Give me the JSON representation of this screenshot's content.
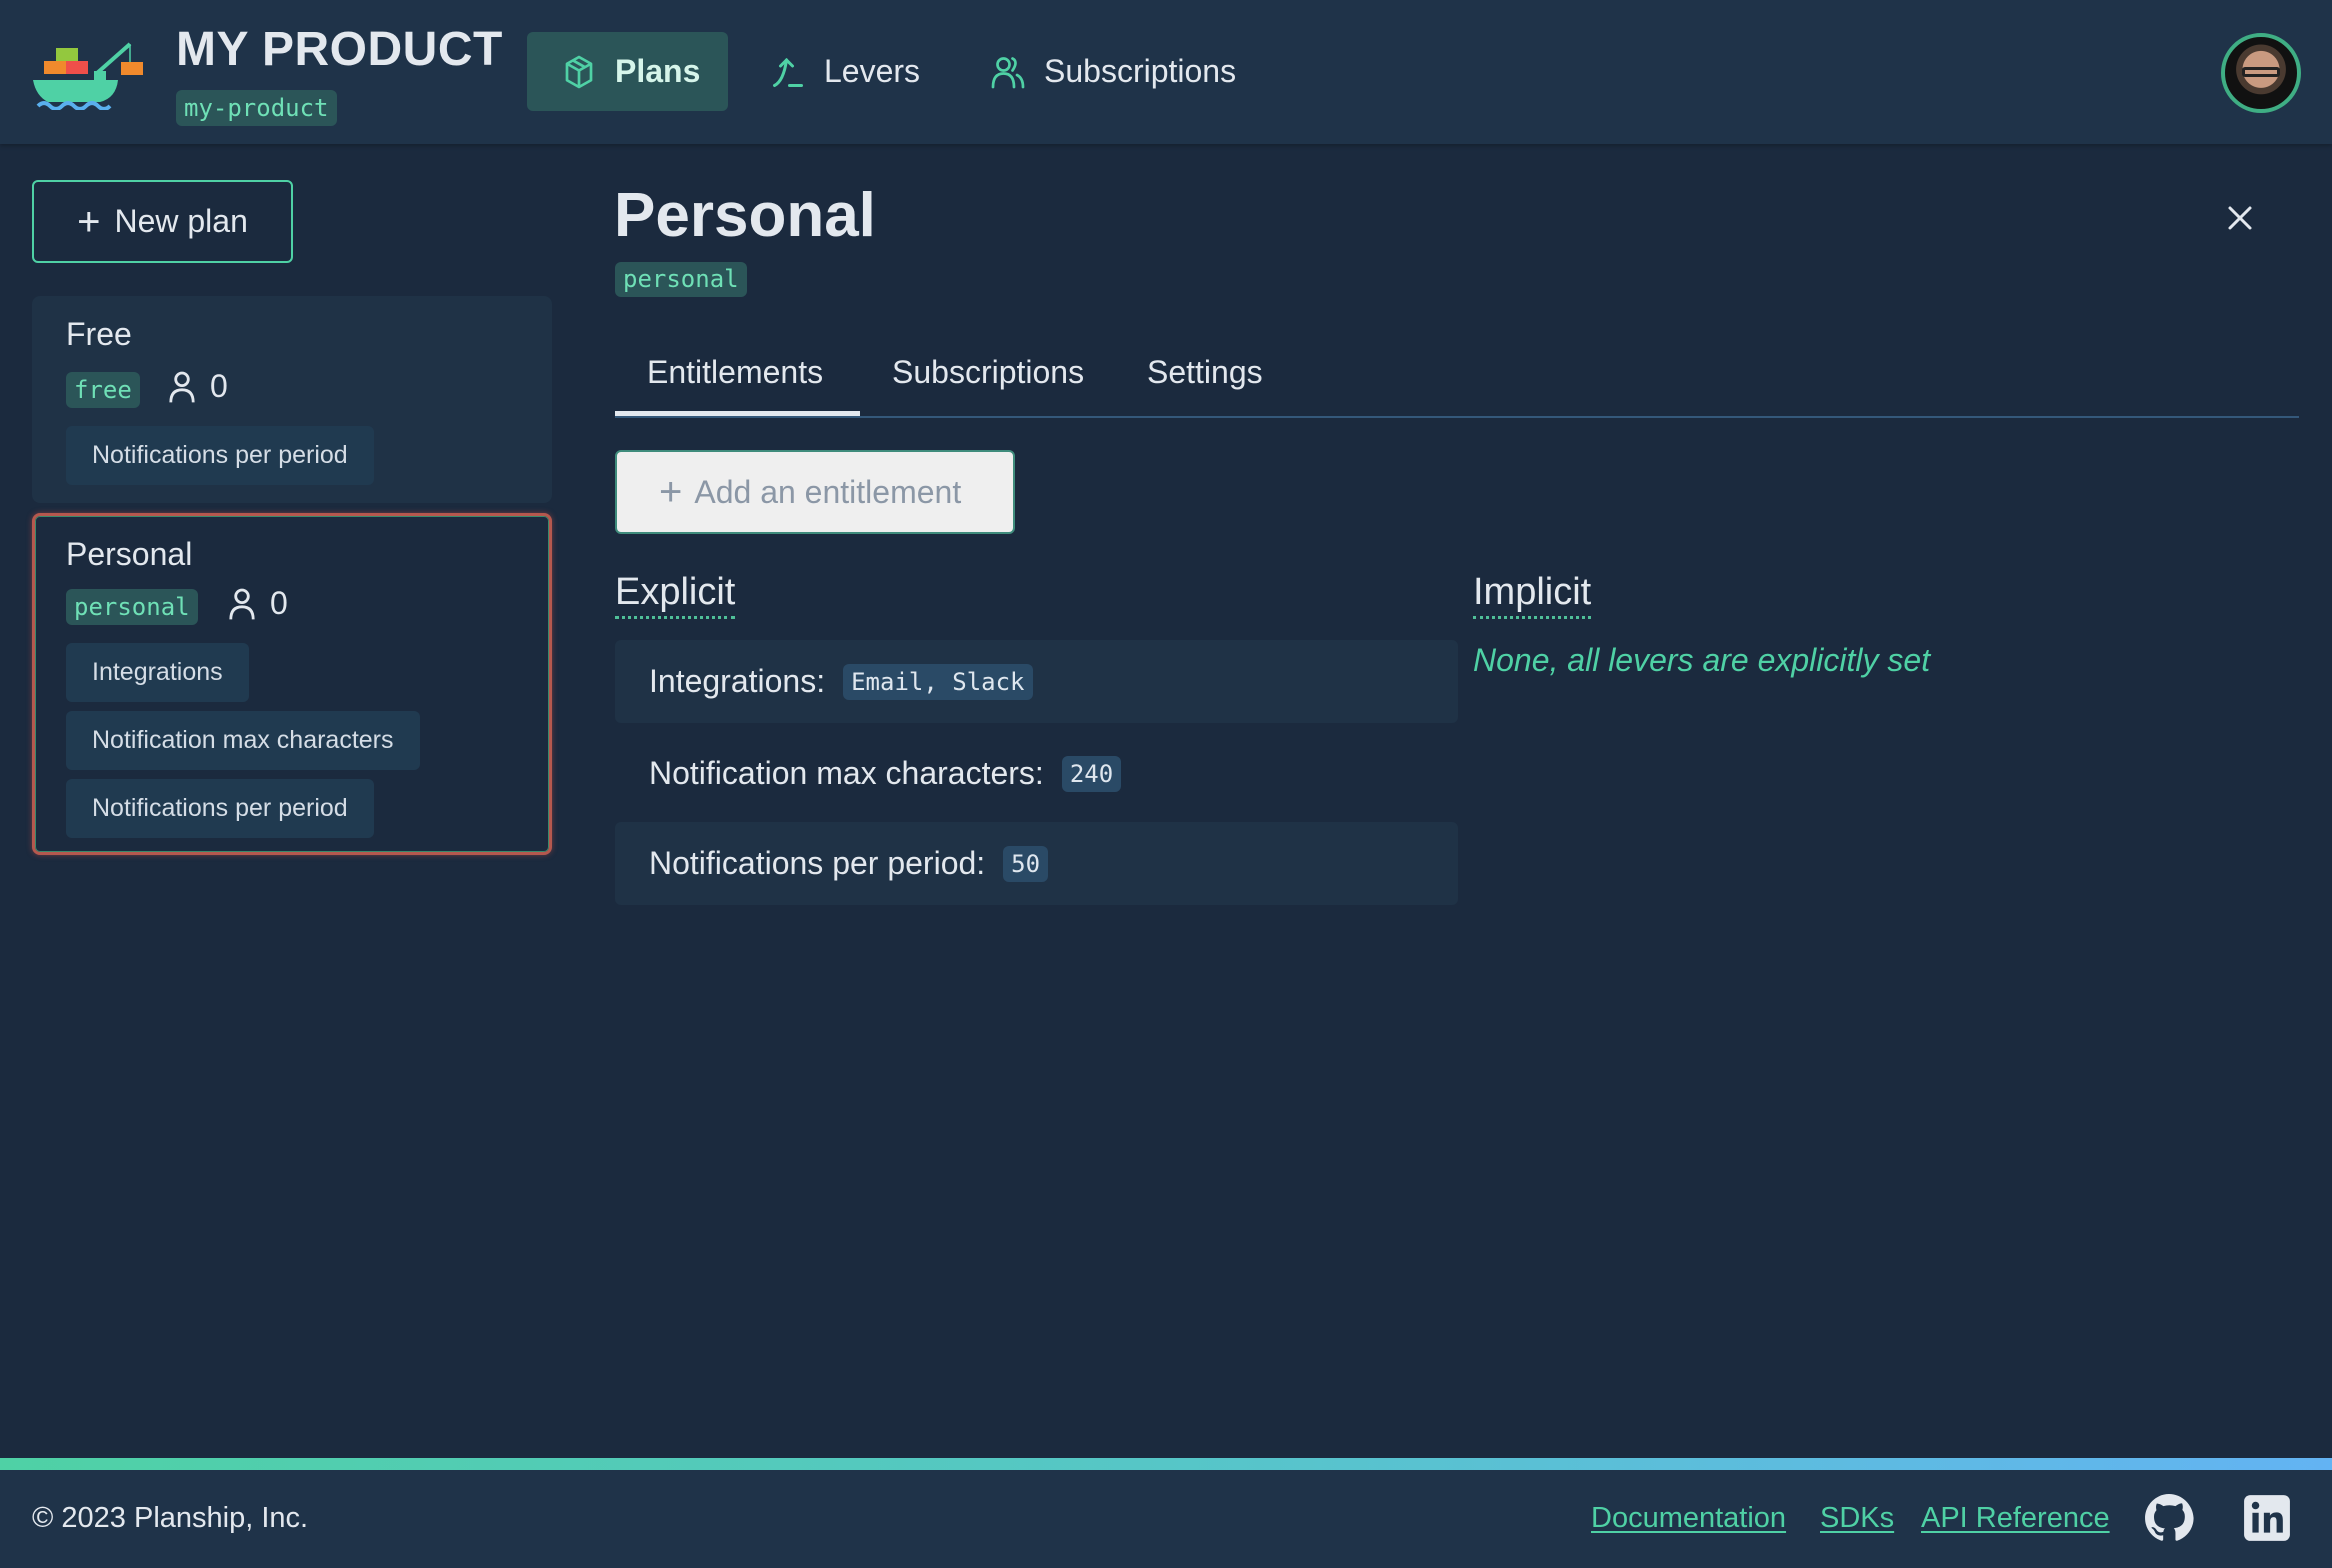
{
  "header": {
    "brand_title": "MY PRODUCT",
    "brand_slug": "my-product",
    "nav": [
      {
        "label": "Plans",
        "icon": "cube-icon",
        "active": true
      },
      {
        "label": "Levers",
        "icon": "lever-icon",
        "active": false
      },
      {
        "label": "Subscriptions",
        "icon": "users-icon",
        "active": false
      }
    ],
    "avatar_alt": "User avatar"
  },
  "sidebar": {
    "new_plan_label": "New plan",
    "plans": [
      {
        "name": "Free",
        "key": "free",
        "subscribers": "0",
        "levers": [
          "Notifications per period"
        ],
        "selected": false
      },
      {
        "name": "Personal",
        "key": "personal",
        "subscribers": "0",
        "levers": [
          "Integrations",
          "Notification max characters",
          "Notifications per period"
        ],
        "selected": true
      }
    ]
  },
  "main": {
    "title": "Personal",
    "key": "personal",
    "tabs": [
      {
        "label": "Entitlements",
        "active": true
      },
      {
        "label": "Subscriptions",
        "active": false
      },
      {
        "label": "Settings",
        "active": false
      }
    ],
    "add_entitlement_label": "Add an entitlement",
    "explicit_heading": "Explicit",
    "implicit_heading": "Implicit",
    "explicit": [
      {
        "label": "Integrations:",
        "value": "Email, Slack"
      },
      {
        "label": "Notification max characters:",
        "value": "240"
      },
      {
        "label": "Notifications per period:",
        "value": "50"
      }
    ],
    "implicit_note": "None, all levers are explicitly set"
  },
  "footer": {
    "copyright": "© 2023 Planship, Inc.",
    "links": [
      "Documentation",
      "SDKs",
      "API Reference"
    ],
    "social": [
      "github-icon",
      "linkedin-icon"
    ]
  },
  "colors": {
    "accent": "#4fd1a5",
    "background": "#1b2a3e",
    "header": "#1f3349",
    "selected_border": "#b5584e"
  }
}
